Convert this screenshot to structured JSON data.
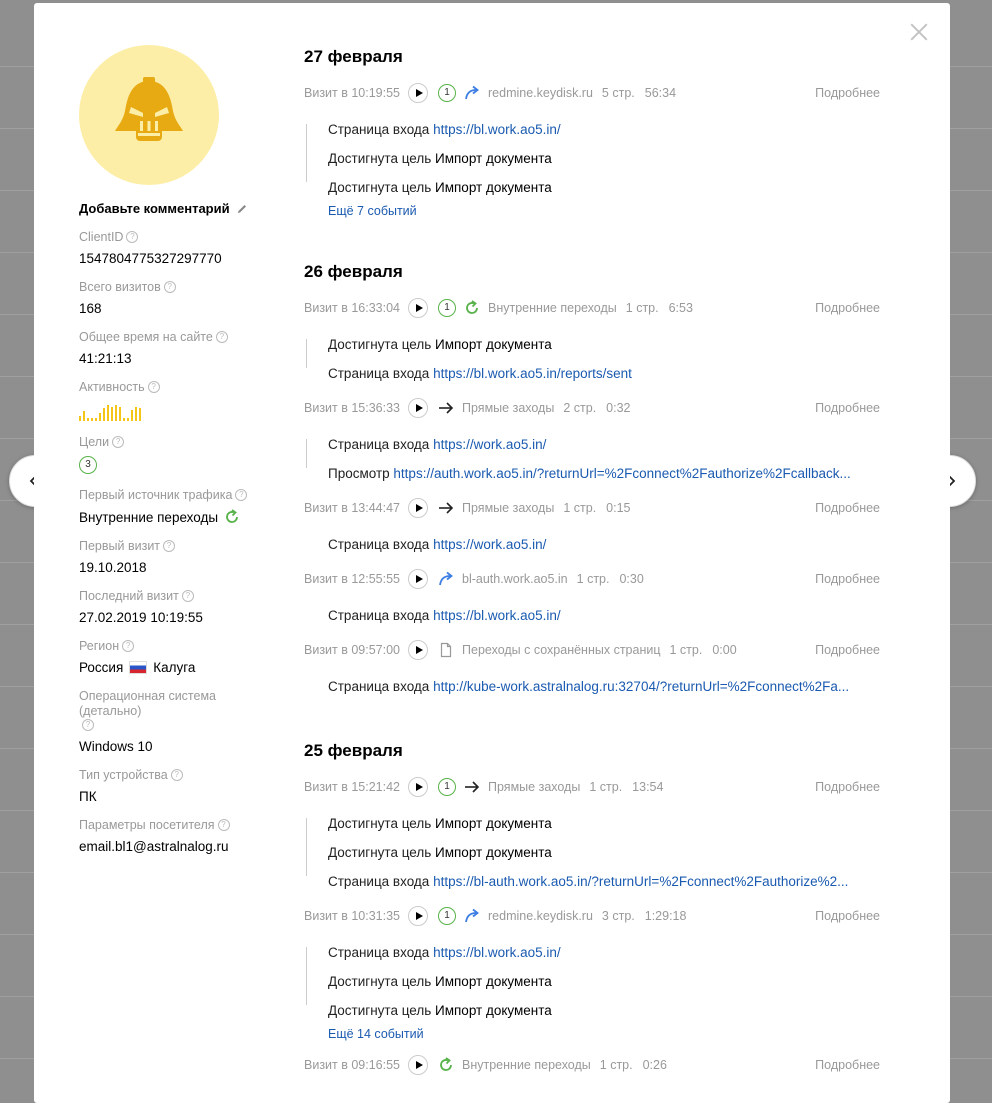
{
  "profile": {
    "comment_label": "Добавьте комментарий",
    "fields": [
      {
        "label": "ClientID",
        "value": "1547804775327297770"
      },
      {
        "label": "Всего визитов",
        "value": "168"
      },
      {
        "label": "Общее время на сайте",
        "value": "41:21:13"
      },
      {
        "label": "Активность",
        "value": ""
      },
      {
        "label": "Цели",
        "value": "3"
      },
      {
        "label": "Первый источник трафика",
        "value": "Внутренние переходы"
      },
      {
        "label": "Первый визит",
        "value": "19.10.2018"
      },
      {
        "label": "Последний визит",
        "value": "27.02.2019 10:19:55"
      },
      {
        "label": "Регион",
        "value_left": "Россия",
        "value_right": "Калуга"
      },
      {
        "label": "Операционная система (детально)",
        "value": "Windows 10"
      },
      {
        "label": "Тип устройства",
        "value": "ПК"
      },
      {
        "label": "Параметры посетителя",
        "value": "email.bl1@astralnalog.ru"
      }
    ],
    "activity_levels": [
      0.3,
      0.6,
      0.2,
      0.2,
      0.2,
      0.5,
      0.8,
      1.0,
      0.9,
      1.0,
      0.9,
      0.2,
      0.2,
      0.7,
      0.9,
      0.8
    ]
  },
  "colors": {
    "link": "#1a5ab0",
    "goal": "#58b24a",
    "avatar_bg": "#fdeea7",
    "avatar_fg": "#e8aa12"
  },
  "days": [
    {
      "title": "27 февраля",
      "visits": [
        {
          "time": "Визит в 10:19:55",
          "goals": "1",
          "source_icon": "referral-arrow-icon",
          "source": "redmine.keydisk.ru",
          "pages": "5 стр.",
          "duration": "56:34",
          "more": "Подробнее",
          "events": [
            {
              "prefix": "Страница входа",
              "link": "https://bl.work.ao5.in/",
              "bold": "",
              "dot": "hollow"
            },
            {
              "prefix": "Достигнута цель",
              "link": "",
              "bold": "Импорт документа",
              "dot": "filled"
            },
            {
              "prefix": "Достигнута цель",
              "link": "",
              "bold": "Импорт документа",
              "dot": "filled"
            }
          ],
          "more_events": "Ещё 7 событий"
        }
      ]
    },
    {
      "title": "26 февраля",
      "visits": [
        {
          "time": "Визит в 16:33:04",
          "goals": "1",
          "source_icon": "internal-refresh-icon",
          "source": "Внутренние переходы",
          "pages": "1 стр.",
          "duration": "6:53",
          "more": "Подробнее",
          "events": [
            {
              "prefix": "Достигнута цель",
              "link": "",
              "bold": "Импорт документа",
              "dot": "filled"
            },
            {
              "prefix": "Страница входа",
              "link": "https://bl.work.ao5.in/reports/sent",
              "bold": "",
              "dot": "hollow"
            }
          ],
          "more_events": ""
        },
        {
          "time": "Визит в 15:36:33",
          "goals": "",
          "source_icon": "direct-arrow-icon",
          "source": "Прямые заходы",
          "pages": "2 стр.",
          "duration": "0:32",
          "more": "Подробнее",
          "events": [
            {
              "prefix": "Страница входа",
              "link": "https://work.ao5.in/",
              "bold": "",
              "dot": "hollow"
            },
            {
              "prefix": "Просмотр",
              "link": "https://auth.work.ao5.in/?returnUrl=%2Fconnect%2Fauthorize%2Fcallback...",
              "bold": "",
              "dot": "hollow"
            }
          ],
          "more_events": ""
        },
        {
          "time": "Визит в 13:44:47",
          "goals": "",
          "source_icon": "direct-arrow-icon",
          "source": "Прямые заходы",
          "pages": "1 стр.",
          "duration": "0:15",
          "more": "Подробнее",
          "events": [
            {
              "prefix": "Страница входа",
              "link": "https://work.ao5.in/",
              "bold": "",
              "dot": "hollow"
            }
          ],
          "more_events": ""
        },
        {
          "time": "Визит в 12:55:55",
          "goals": "",
          "source_icon": "referral-arrow-icon",
          "source": "bl-auth.work.ao5.in",
          "pages": "1 стр.",
          "duration": "0:30",
          "more": "Подробнее",
          "events": [
            {
              "prefix": "Страница входа",
              "link": "https://bl.work.ao5.in/",
              "bold": "",
              "dot": "hollow"
            }
          ],
          "more_events": ""
        },
        {
          "time": "Визит в 09:57:00",
          "goals": "",
          "source_icon": "saved-page-icon",
          "source": "Переходы с сохранённых страниц",
          "pages": "1 стр.",
          "duration": "0:00",
          "more": "Подробнее",
          "events": [
            {
              "prefix": "Страница входа",
              "link": "http://kube-work.astralnalog.ru:32704/?returnUrl=%2Fconnect%2Fa...",
              "bold": "",
              "dot": "hollow"
            }
          ],
          "more_events": ""
        }
      ]
    },
    {
      "title": "25 февраля",
      "visits": [
        {
          "time": "Визит в 15:21:42",
          "goals": "1",
          "source_icon": "direct-arrow-icon",
          "source": "Прямые заходы",
          "pages": "1 стр.",
          "duration": "13:54",
          "more": "Подробнее",
          "events": [
            {
              "prefix": "Достигнута цель",
              "link": "",
              "bold": "Импорт документа",
              "dot": "filled"
            },
            {
              "prefix": "Достигнута цель",
              "link": "",
              "bold": "Импорт документа",
              "dot": "filled"
            },
            {
              "prefix": "Страница входа",
              "link": "https://bl-auth.work.ao5.in/?returnUrl=%2Fconnect%2Fauthorize%2...",
              "bold": "",
              "dot": "hollow"
            }
          ],
          "more_events": ""
        },
        {
          "time": "Визит в 10:31:35",
          "goals": "1",
          "source_icon": "referral-arrow-icon",
          "source": "redmine.keydisk.ru",
          "pages": "3 стр.",
          "duration": "1:29:18",
          "more": "Подробнее",
          "events": [
            {
              "prefix": "Страница входа",
              "link": "https://bl.work.ao5.in/",
              "bold": "",
              "dot": "hollow"
            },
            {
              "prefix": "Достигнута цель",
              "link": "",
              "bold": "Импорт документа",
              "dot": "filled"
            },
            {
              "prefix": "Достигнута цель",
              "link": "",
              "bold": "Импорт документа",
              "dot": "filled"
            }
          ],
          "more_events": "Ещё 14 событий"
        },
        {
          "time": "Визит в 09:16:55",
          "goals": "",
          "source_icon": "internal-refresh-icon",
          "source": "Внутренние переходы",
          "pages": "1 стр.",
          "duration": "0:26",
          "more": "Подробнее",
          "events": [],
          "more_events": ""
        }
      ]
    }
  ]
}
